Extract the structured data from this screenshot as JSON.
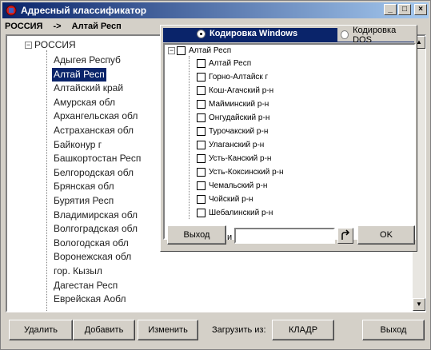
{
  "window": {
    "title": "Адресный классификатор",
    "controls": [
      "_",
      "□",
      "×"
    ]
  },
  "path": {
    "root": "РОССИЯ",
    "arrow": "->",
    "current": "Алтай Респ"
  },
  "tree": {
    "root_toggle": "−",
    "root_label": "РОССИЯ",
    "items": [
      "Адыгея Респуб",
      "Алтай Респ",
      "Алтайский край",
      "Амурская обл",
      "Архангельская обл",
      "Астраханская обл",
      "Байконур г",
      "Башкортостан Респ",
      "Белгородская обл",
      "Брянская обл",
      "Бурятия Респ",
      "Владимирская обл",
      "Волгоградская обл",
      "Вологодская обл",
      "Воронежская обл",
      "гор. Кызыл",
      "Дагестан Респ",
      "Еврейская Аобл"
    ],
    "selected": "Алтай Респ"
  },
  "buttons": {
    "delete": "Удалить",
    "add": "Добавить",
    "edit": "Изменить",
    "load_from_label": "Загрузить из:",
    "kladr": "КЛАДР",
    "exit": "Выход"
  },
  "popup": {
    "encoding_windows": "Кодировка Windows",
    "encoding_dos": "Кодировка DOS",
    "selected_encoding": "Windows",
    "root_toggle": "−",
    "root_label": "Алтай Респ",
    "items": [
      "Алтай Респ",
      "Горно-Алтайск г",
      "Кош-Агачский р-н",
      "Майминский р-н",
      "Онгудайский р-н",
      "Турочакский р-н",
      "Улаганский р-н",
      "Усть-Канский р-н",
      "Усть-Коксинский р-н",
      "Чемальский р-н",
      "Чойский р-н",
      "Шебалинский р-н"
    ],
    "exit": "Выход",
    "letter": "и",
    "search_value": "",
    "ok": "OK"
  }
}
